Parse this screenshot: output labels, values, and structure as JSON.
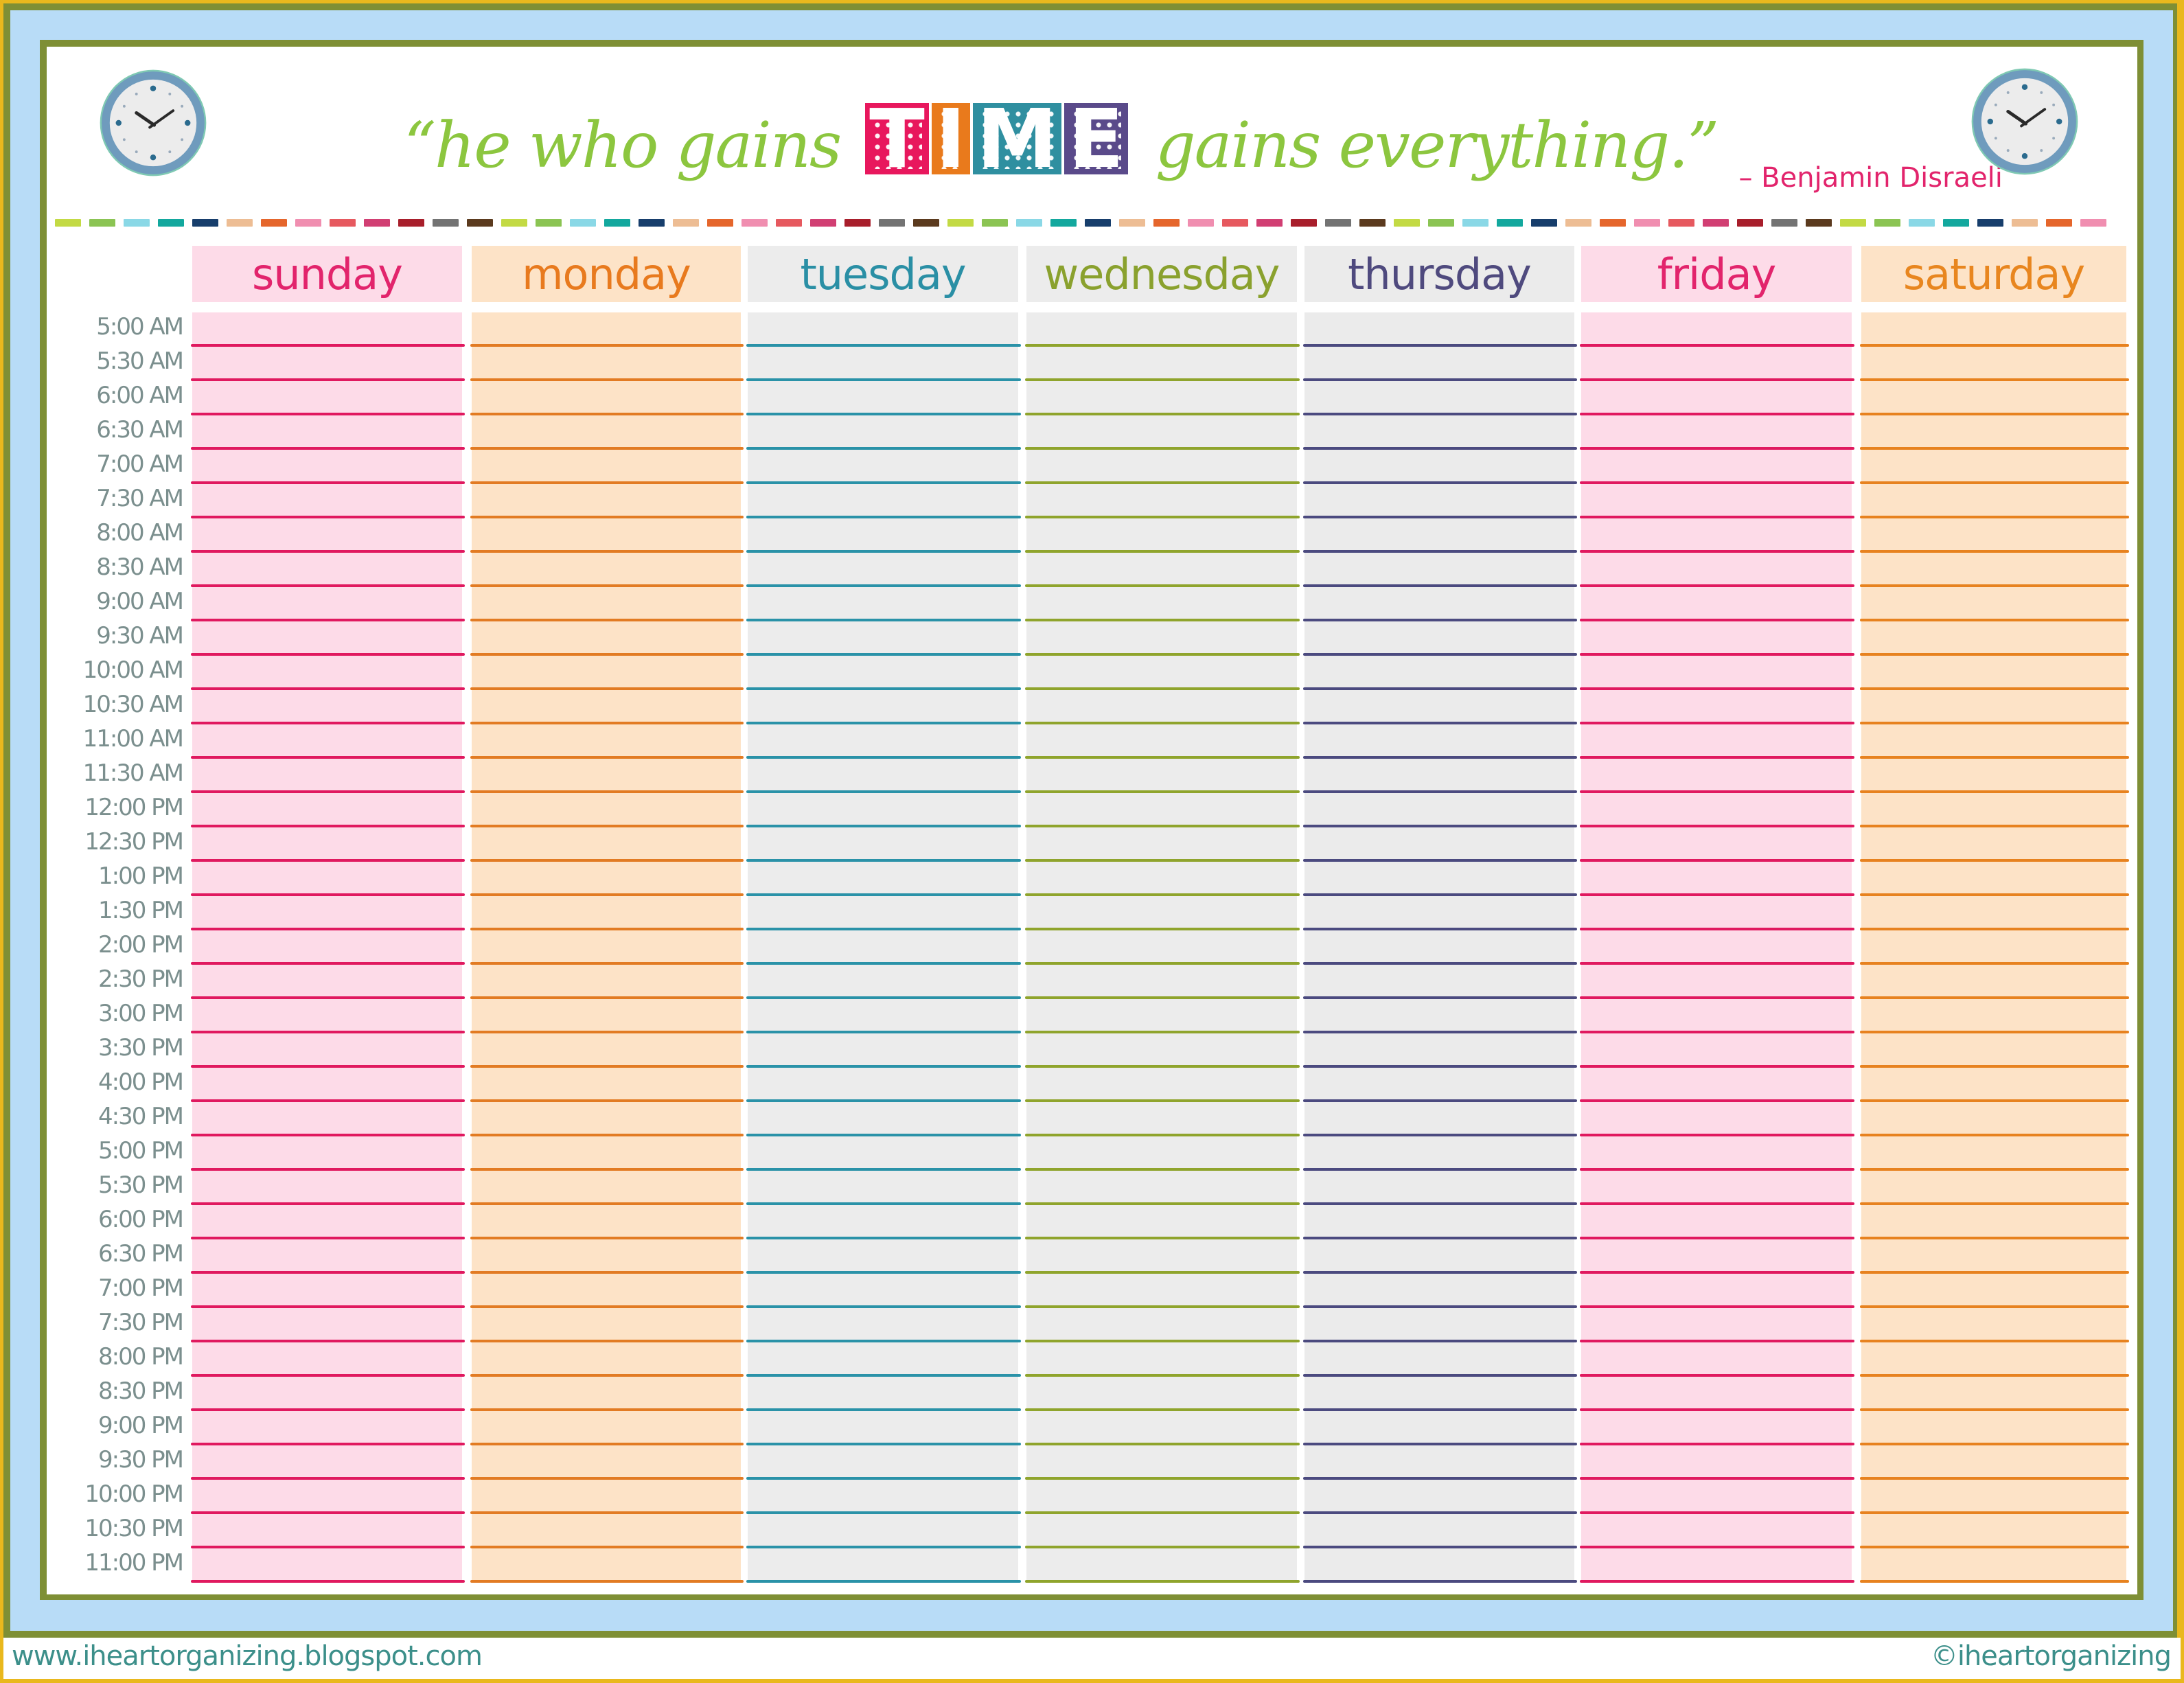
{
  "header": {
    "quote_open": "“he who gains",
    "quote_emphasis": [
      "T",
      "I",
      "M",
      "E"
    ],
    "quote_close": "gains everything.”",
    "attribution": "– Benjamin Disraeli",
    "left_icon": "clock-icon",
    "right_icon": "clock-icon",
    "emphasis_colors": [
      "#e8175d",
      "#e97a1c",
      "#2f8fa0",
      "#5a4a8a"
    ]
  },
  "color_strip": [
    "#c3da44",
    "#8bc453",
    "#8ad8e6",
    "#13a89e",
    "#173e6c",
    "#edbd94",
    "#e5662c",
    "#f08eb0",
    "#e6595f",
    "#d13f73",
    "#a81e2b",
    "#737373",
    "#5b3a1e"
  ],
  "days": [
    {
      "label": "sunday",
      "text_color": "#e2246c",
      "header_bg": "#fddbe8",
      "body_bg": "#fddbe8",
      "line_color": "#e0195f"
    },
    {
      "label": "monday",
      "text_color": "#e87a1e",
      "header_bg": "#fde3c7",
      "body_bg": "#fde3c7",
      "line_color": "#e27b23"
    },
    {
      "label": "tuesday",
      "text_color": "#2a8fa5",
      "header_bg": "#ececec",
      "body_bg": "#ececec",
      "line_color": "#2a92a8"
    },
    {
      "label": "wednesday",
      "text_color": "#8aa12e",
      "header_bg": "#ececec",
      "body_bg": "#ececec",
      "line_color": "#8fa42c"
    },
    {
      "label": "thursday",
      "text_color": "#4f4a7e",
      "header_bg": "#ebebeb",
      "body_bg": "#ebebeb",
      "line_color": "#4b4a7f"
    },
    {
      "label": "friday",
      "text_color": "#e2246c",
      "header_bg": "#fddbe8",
      "body_bg": "#fddbe8",
      "line_color": "#e0195f"
    },
    {
      "label": "saturday",
      "text_color": "#e8861f",
      "header_bg": "#fde3c7",
      "body_bg": "#fde3c7",
      "line_color": "#e7821f"
    }
  ],
  "time_slots": [
    "5:00 AM",
    "5:30 AM",
    "6:00 AM",
    "6:30 AM",
    "7:00 AM",
    "7:30 AM",
    "8:00 AM",
    "8:30 AM",
    "9:00 AM",
    "9:30 AM",
    "10:00 AM",
    "10:30 AM",
    "11:00 AM",
    "11:30 AM",
    "12:00 PM",
    "12:30 PM",
    "1:00 PM",
    "1:30 PM",
    "2:00 PM",
    "2:30 PM",
    "3:00 PM",
    "3:30 PM",
    "4:00 PM",
    "4:30 PM",
    "5:00 PM",
    "5:30 PM",
    "6:00 PM",
    "6:30 PM",
    "7:00 PM",
    "7:30 PM",
    "8:00 PM",
    "8:30 PM",
    "9:00 PM",
    "9:30 PM",
    "10:00 PM",
    "10:30 PM",
    "11:00 PM"
  ],
  "footer": {
    "website": "www.iheartorganizing.blogspot.com",
    "copyright": "©iheartorganizing"
  }
}
